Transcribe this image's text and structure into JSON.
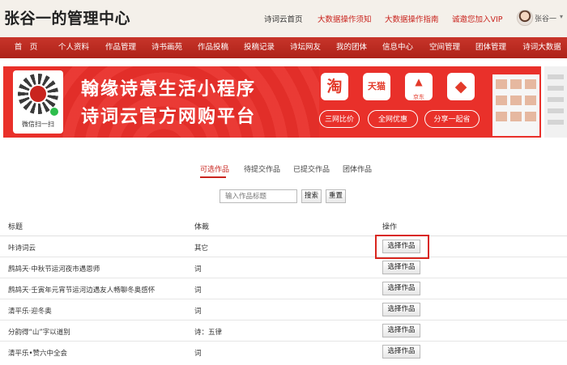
{
  "header": {
    "title": "张谷一的管理中心",
    "links": [
      "诗词云首页",
      "大数据操作须知",
      "大数据操作指南",
      "诚邀您加入VIP"
    ],
    "user": {
      "name": "张谷一"
    }
  },
  "nav": {
    "items": [
      "首　页",
      "个人资料",
      "作品管理",
      "诗书画苑",
      "作品投稿",
      "投稿记录",
      "诗坛网友",
      "我的团体",
      "信息中心",
      "空间管理",
      "团体管理",
      "诗词大数据"
    ]
  },
  "banner": {
    "qr_caption": "微信扫一扫",
    "headline_1": "翰缘诗意生活小程序",
    "headline_2": "诗词云官方网购平台",
    "apps": [
      {
        "glyph": "淘",
        "label": ""
      },
      {
        "glyph": "天猫",
        "label": ""
      },
      {
        "glyph": "▲",
        "label": "京东"
      },
      {
        "glyph": "◆",
        "label": ""
      }
    ],
    "pills": [
      "三网比价",
      "全网优惠",
      "分享一起省"
    ]
  },
  "tabs": [
    "可选作品",
    "待提交作品",
    "已提交作品",
    "团体作品"
  ],
  "search": {
    "placeholder": "输入作品标题",
    "search_label": "搜索",
    "reset_label": "重置"
  },
  "table": {
    "headers": [
      "标题",
      "体裁",
      "操作"
    ],
    "rows": [
      {
        "title": "咔诗词云",
        "genre": "其它",
        "action": "选择作品"
      },
      {
        "title": "鹧鸪天·中秋节运河夜市遇恩师",
        "genre": "词",
        "action": "选择作品"
      },
      {
        "title": "鹧鸪天·壬寅年元宵节运河边遇友人畅聊冬奥感怀",
        "genre": "词",
        "action": "选择作品"
      },
      {
        "title": "清平乐·迎冬奥",
        "genre": "词",
        "action": "选择作品"
      },
      {
        "title": "分韵得“山”字以道别",
        "genre": "诗：五律",
        "action": "选择作品"
      },
      {
        "title": "清平乐•赞六中全会",
        "genre": "词",
        "action": "选择作品"
      }
    ]
  },
  "colors": {
    "accent": "#c9241e",
    "nav_bg": "#b8271d",
    "header_bg": "#f4f0ea",
    "banner_bg": "#e9302a"
  }
}
